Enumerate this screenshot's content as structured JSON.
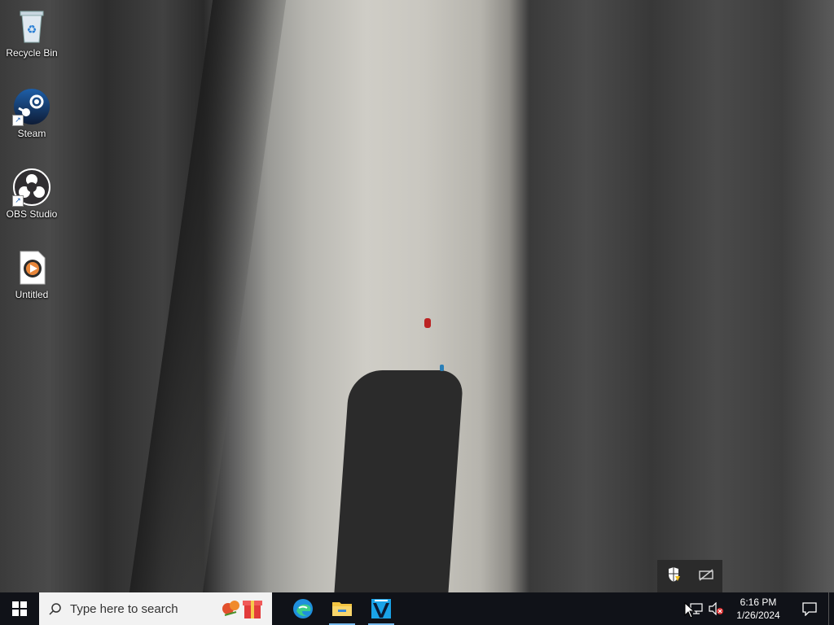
{
  "desktop": {
    "icons": [
      {
        "label": "Recycle Bin",
        "icon": "recycle-bin-icon"
      },
      {
        "label": "Steam",
        "icon": "steam-icon"
      },
      {
        "label": "OBS Studio",
        "icon": "obs-studio-icon"
      },
      {
        "label": "Untitled",
        "icon": "media-file-icon"
      }
    ]
  },
  "taskbar": {
    "search_placeholder": "Type here to search",
    "apps": [
      {
        "name": "Microsoft Edge",
        "icon": "edge-icon"
      },
      {
        "name": "File Explorer",
        "icon": "file-explorer-icon",
        "active": true
      },
      {
        "name": "App",
        "icon": "pinned-app-icon",
        "active": true
      }
    ],
    "clock": {
      "time": "6:16 PM",
      "date": "1/26/2024"
    }
  },
  "tray_flyout": {
    "icons": [
      "security-warning-icon",
      "network-off-icon"
    ]
  },
  "colors": {
    "taskbar_bg": "#101218",
    "search_bg": "#f2f2f2",
    "accent": "#76b9ed"
  }
}
